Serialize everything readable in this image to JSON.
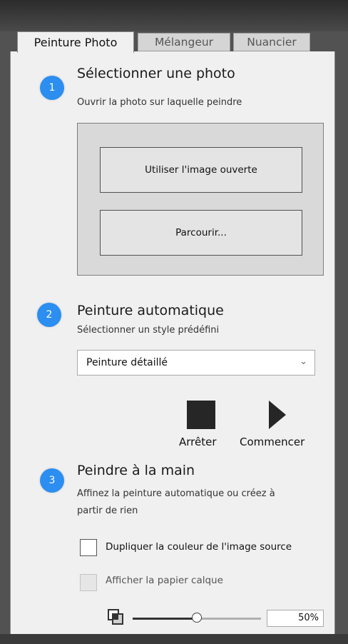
{
  "tabs": [
    {
      "label": "Peinture Photo",
      "active": true
    },
    {
      "label": "Mélangeur",
      "active": false
    },
    {
      "label": "Nuancier",
      "active": false
    }
  ],
  "step1": {
    "number": "1",
    "title": "Sélectionner une photo",
    "subtitle": "Ouvrir la photo sur laquelle peindre",
    "use_open_image_label": "Utiliser l'image ouverte",
    "browse_label": "Parcourir..."
  },
  "step2": {
    "number": "2",
    "title": "Peinture automatique",
    "subtitle": "Sélectionner un style prédéfini",
    "style_selected": "Peinture détaillé",
    "stop_label": "Arrêter",
    "start_label": "Commencer"
  },
  "step3": {
    "number": "3",
    "title": "Peindre à la main",
    "subtitle_line1": "Affinez la peinture automatique ou créez à",
    "subtitle_line2": "partir de rien",
    "duplicate_color_label": "Dupliquer la couleur de l'image source",
    "duplicate_color_checked": false,
    "show_tracing_label": "Afficher la papier calque",
    "show_tracing_enabled": false,
    "opacity_value": "50%",
    "opacity_fraction": 0.5
  },
  "colors": {
    "accent": "#2b8ef0",
    "panel_bg": "#f0f0f0",
    "frame_dark": "#525252"
  },
  "icons": {
    "dropdown": "chevron-down-icon",
    "stop": "stop-icon",
    "play": "play-icon",
    "layers": "layers-icon"
  }
}
